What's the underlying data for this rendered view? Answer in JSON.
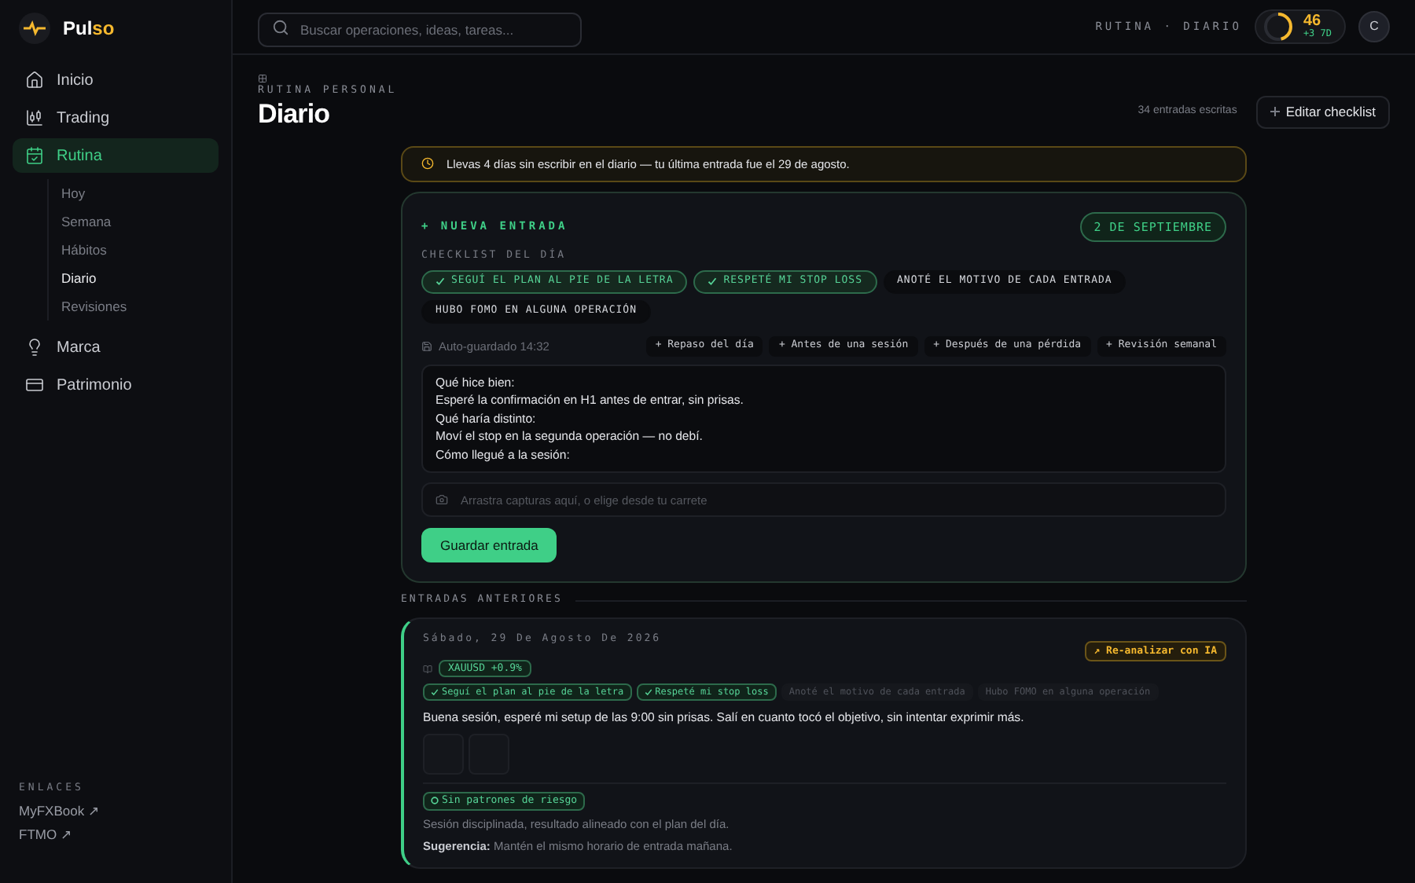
{
  "brand": {
    "name_start": "Pul",
    "name_end": "so"
  },
  "search": {
    "placeholder": "Buscar operaciones, ideas, tareas..."
  },
  "topbar": {
    "breadcrumb": "RUTINA · DIARIO",
    "score": {
      "value": "46",
      "delta": "+3 7D",
      "level": 0.46
    },
    "avatar": "C"
  },
  "sidebar": {
    "items": [
      {
        "label": "Inicio",
        "selected": false
      },
      {
        "label": "Trading",
        "selected": false
      },
      {
        "label": "Rutina",
        "selected": true,
        "children": [
          {
            "label": "Hoy",
            "selected": false
          },
          {
            "label": "Semana",
            "selected": false
          },
          {
            "label": "Hábitos",
            "selected": false
          },
          {
            "label": "Diario",
            "selected": true
          },
          {
            "label": "Revisiones",
            "selected": false
          }
        ]
      },
      {
        "label": "Marca",
        "selected": false
      },
      {
        "label": "Patrimonio",
        "selected": false
      }
    ],
    "links_title": "ENLACES",
    "links": [
      "MyFXBook ↗",
      "FTMO ↗"
    ]
  },
  "page": {
    "eyebrow": "RUTINA PERSONAL",
    "title": "Diario",
    "count": "34 entradas escritas",
    "edit_button": "Editar checklist"
  },
  "alert": "Llevas 4 días sin escribir en el diario — tu última entrada fue el 29 de agosto.",
  "new_entry": {
    "title": "+ NUEVA ENTRADA",
    "date": "2 DE SEPTIEMBRE",
    "checklist_label": "CHECKLIST DEL DÍA",
    "checklist": [
      {
        "label": "SEGUÍ EL PLAN AL PIE DE LA LETRA",
        "checked": true
      },
      {
        "label": "RESPETÉ MI STOP LOSS",
        "checked": true
      },
      {
        "label": "ANOTÉ EL MOTIVO DE CADA ENTRADA",
        "checked": false
      },
      {
        "label": "HUBO FOMO EN ALGUNA OPERACIÓN",
        "checked": false
      }
    ],
    "autosave": "Auto-guardado 14:32",
    "templates": [
      "+ Repaso del día",
      "+ Antes de una sesión",
      "+ Después de una pérdida",
      "+ Revisión semanal"
    ],
    "text": {
      "value": "Qué hice bien:\nEsperé la confirmación en H1 antes de entrar, sin prisas.\nQué haría distinto:\nMoví el stop en la segunda operación — no debí.\nCómo llegué a la sesión:"
    },
    "upload": {
      "placeholder": "Arrastra capturas aquí, o elige desde tu carrete"
    },
    "save_button": "Guardar entrada"
  },
  "previous": {
    "title": "ENTRADAS ANTERIORES",
    "entries": [
      {
        "date": "Sábado, 29 De Agosto De 2026",
        "reanalyze": "↗ Re-analizar con IA",
        "trade_tag": "XAUUSD +0.9%",
        "checklist": [
          {
            "label": "Seguí el plan al pie de la letra",
            "checked": true
          },
          {
            "label": "Respeté mi stop loss",
            "checked": true
          },
          {
            "label": "Anoté el motivo de cada entrada",
            "checked": false
          },
          {
            "label": "Hubo FOMO en alguna operación",
            "checked": false
          }
        ],
        "body": "Buena sesión, esperé mi setup de las 9:00 sin prisas. Salí en cuanto tocó el objetivo, sin intentar exprimir más.",
        "attachments": [
          {
            "kind": "image"
          },
          {
            "kind": "image"
          }
        ],
        "risk_tag": "Sin patrones de riesgo",
        "analysis": "Sesión disciplinada, resultado alineado con el plan del día.",
        "suggestion": "**Sugerencia:** Mantén el mismo horario de entrada mañana."
      }
    ]
  }
}
